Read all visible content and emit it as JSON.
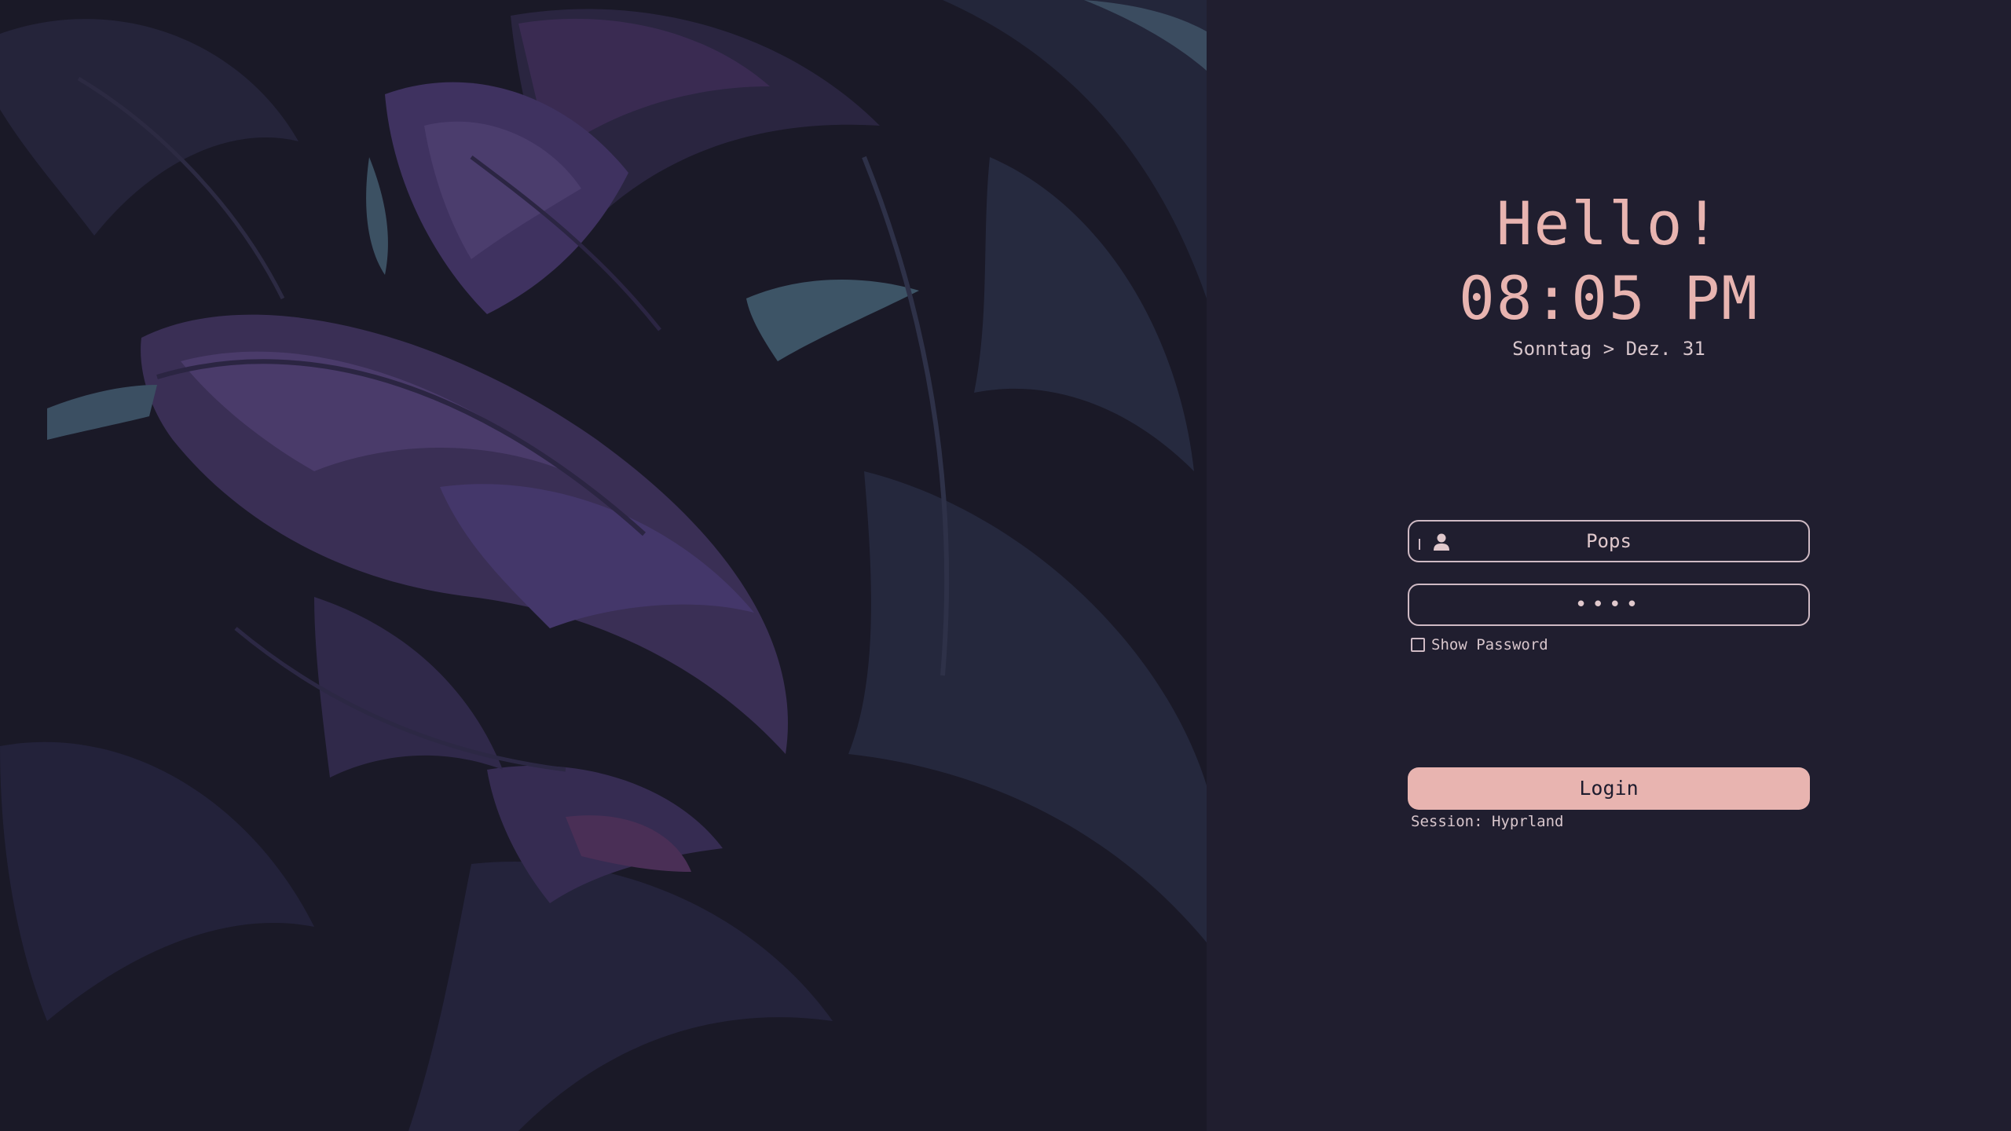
{
  "greeter": {
    "greeting": "Hello!",
    "time": "08:05 PM",
    "date": "Sonntag > Dez. 31"
  },
  "login_form": {
    "username_value": "Pops",
    "password_value": "••••",
    "show_password_label": "Show Password",
    "show_password_checked": false,
    "login_label": "Login",
    "session_label": "Session: Hyprland"
  },
  "icons": {
    "user_field_icon": "user-icon",
    "show_password_icon": "checkbox-icon"
  },
  "colors": {
    "panel_background": "#201e2f",
    "accent": "#e8b4b0",
    "text": "#d8c6cc",
    "field_border": "#cfbac4",
    "wallpaper_purple": "#3b2f57",
    "wallpaper_teal": "#344a5c"
  }
}
